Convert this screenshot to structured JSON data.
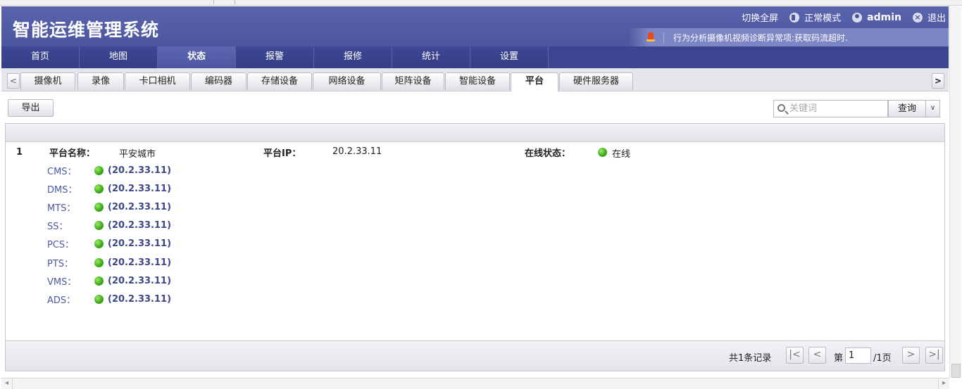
{
  "app": {
    "title": "智能运维管理系统"
  },
  "top_links": {
    "fullscreen": "切换全屏",
    "mode": "正常模式",
    "user": "admin",
    "logout": "退出"
  },
  "alarm": {
    "text": "行为分析摄像机视频诊断异常项:获取码流超时."
  },
  "nav": {
    "items": [
      "首页",
      "地图",
      "状态",
      "报警",
      "报修",
      "统计",
      "设置"
    ],
    "active": "状态"
  },
  "tabs": {
    "scroll_left": "<",
    "scroll_right": ">",
    "items": [
      "摄像机",
      "录像",
      "卡口相机",
      "编码器",
      "存储设备",
      "网络设备",
      "矩阵设备",
      "智能设备",
      "平台",
      "硬件服务器"
    ],
    "active": "平台"
  },
  "toolbar": {
    "export_label": "导出",
    "search_placeholder": "关键词",
    "query_label": "查询",
    "dropdown_glyph": "∨"
  },
  "platform_record": {
    "index": "1",
    "name_label": "平台名称：",
    "name_value": "平安城市",
    "ip_label": "平台IP：",
    "ip_value": "20.2.33.11",
    "status_label": "在线状态：",
    "status_value": "在线",
    "status_color": "#3aa615",
    "services": [
      {
        "name": "CMS：",
        "ip": "(20.2.33.11)"
      },
      {
        "name": "DMS：",
        "ip": "(20.2.33.11)"
      },
      {
        "name": "MTS：",
        "ip": "(20.2.33.11)"
      },
      {
        "name": "SS：",
        "ip": "(20.2.33.11)"
      },
      {
        "name": "PCS：",
        "ip": "(20.2.33.11)"
      },
      {
        "name": "PTS：",
        "ip": "(20.2.33.11)"
      },
      {
        "name": "VMS：",
        "ip": "(20.2.33.11)"
      },
      {
        "name": "ADS：",
        "ip": "(20.2.33.11)"
      }
    ]
  },
  "pagination": {
    "record_count": "共1条记录",
    "page_prefix": "第",
    "current_page": "1",
    "page_suffix": "/1页",
    "first_glyph": "|<",
    "prev_glyph": "<",
    "next_glyph": ">",
    "last_glyph": ">|"
  },
  "colors": {
    "header": "#4b569f",
    "nav": "#3c4590",
    "online": "#3aa615"
  }
}
